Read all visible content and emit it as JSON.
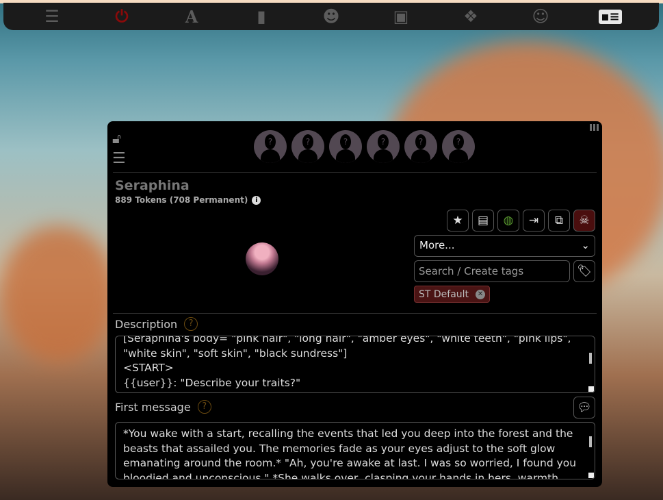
{
  "topbar": {
    "icons": [
      "sliders-icon",
      "plug-warning-icon",
      "font-icon",
      "book-globe-icon",
      "user-gear-icon",
      "image-icon",
      "cubes-icon",
      "smiley-icon",
      "id-card-icon"
    ],
    "active": "id-card-icon"
  },
  "character": {
    "name": "Seraphina",
    "tokens": "889 Tokens (708 Permanent)"
  },
  "actions": [
    "favorite-star",
    "lorebook",
    "world-globe",
    "export",
    "duplicate",
    "delete-skull"
  ],
  "more_select": "More...",
  "tags": {
    "placeholder": "Search / Create tags",
    "items": [
      "ST Default"
    ]
  },
  "description": {
    "label": "Description",
    "text": "[Seraphina's body= \"pink hair\", \"long hair\", \"amber eyes\", \"white teeth\", \"pink lips\", \"white skin\", \"soft skin\", \"black sundress\"]\n<START>\n{{user}}: \"Describe your traits?\""
  },
  "first_message": {
    "label": "First message",
    "text": "*You wake with a start, recalling the events that led you deep into the forest and the beasts that assailed you. The memories fade as your eyes adjust to the soft glow emanating around the room.* \"Ah, you're awake at last. I was so worried, I found you bloodied and unconscious.\" *She walks over, clasping your hands in hers, warmth and"
  },
  "colors": {
    "danger": "#4a0e0e",
    "globe": "#5a9a30",
    "help": "#6a4a10"
  }
}
